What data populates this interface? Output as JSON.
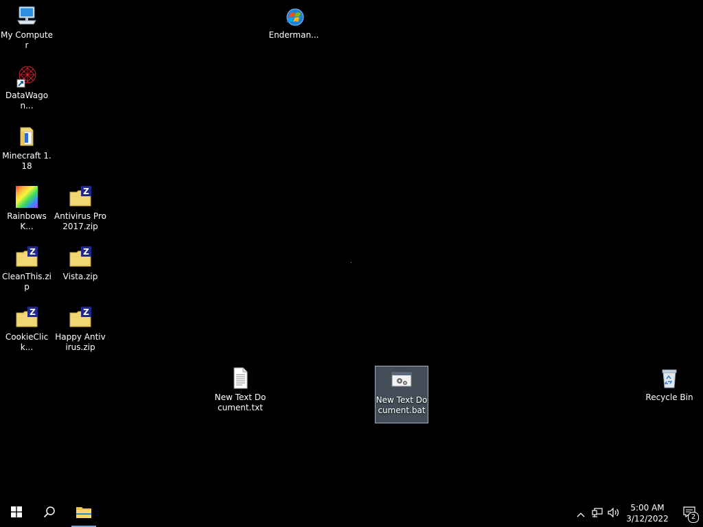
{
  "desktop": {
    "icons": {
      "my_computer": {
        "label": "My Computer",
        "icon": "computer-icon"
      },
      "enderman": {
        "label": "Enderman...",
        "icon": "windows-logo-globe-icon"
      },
      "datawagon": {
        "label": "DataWagon...",
        "icon": "datawagon-shortcut-icon"
      },
      "minecraft": {
        "label": "Minecraft 1.18",
        "icon": "folder-icon"
      },
      "rainbows": {
        "label": "RainbowsK...",
        "icon": "rainbow-image-icon"
      },
      "antivirus_pro": {
        "label": "Antivirus Pro 2017.zip",
        "icon": "zip-folder-icon"
      },
      "cleanthis": {
        "label": "CleanThis.zip",
        "icon": "zip-folder-icon"
      },
      "vista": {
        "label": "Vista.zip",
        "icon": "zip-folder-icon"
      },
      "cookieclick": {
        "label": "CookieClick...",
        "icon": "zip-folder-icon"
      },
      "happy_antivirus": {
        "label": "Happy Antivirus.zip",
        "icon": "zip-folder-icon"
      },
      "new_text_txt": {
        "label": "New Text Document.txt",
        "icon": "text-document-icon"
      },
      "new_text_bat": {
        "label": "New Text Document.bat",
        "icon": "batch-file-icon",
        "selected": true
      },
      "recycle_bin": {
        "label": "Recycle Bin",
        "icon": "recycle-bin-icon"
      }
    }
  },
  "taskbar": {
    "start": {
      "icon": "windows-start-icon"
    },
    "search": {
      "icon": "search-icon"
    },
    "file_explorer": {
      "icon": "file-explorer-icon",
      "active": true
    },
    "tray": {
      "chevron": {
        "icon": "chevron-up-icon"
      },
      "network": {
        "icon": "network-icon"
      },
      "volume": {
        "icon": "volume-icon"
      }
    },
    "clock": {
      "time": "5:00 AM",
      "date": "3/12/2022"
    },
    "notifications": {
      "icon": "action-center-icon",
      "count": "2"
    }
  },
  "colors": {
    "background": "#000000",
    "selection": "#788ca0",
    "folder": "#f3d774",
    "zip_badge": "#1f2a8a",
    "taskbar_accent": "#7aa7d8"
  }
}
